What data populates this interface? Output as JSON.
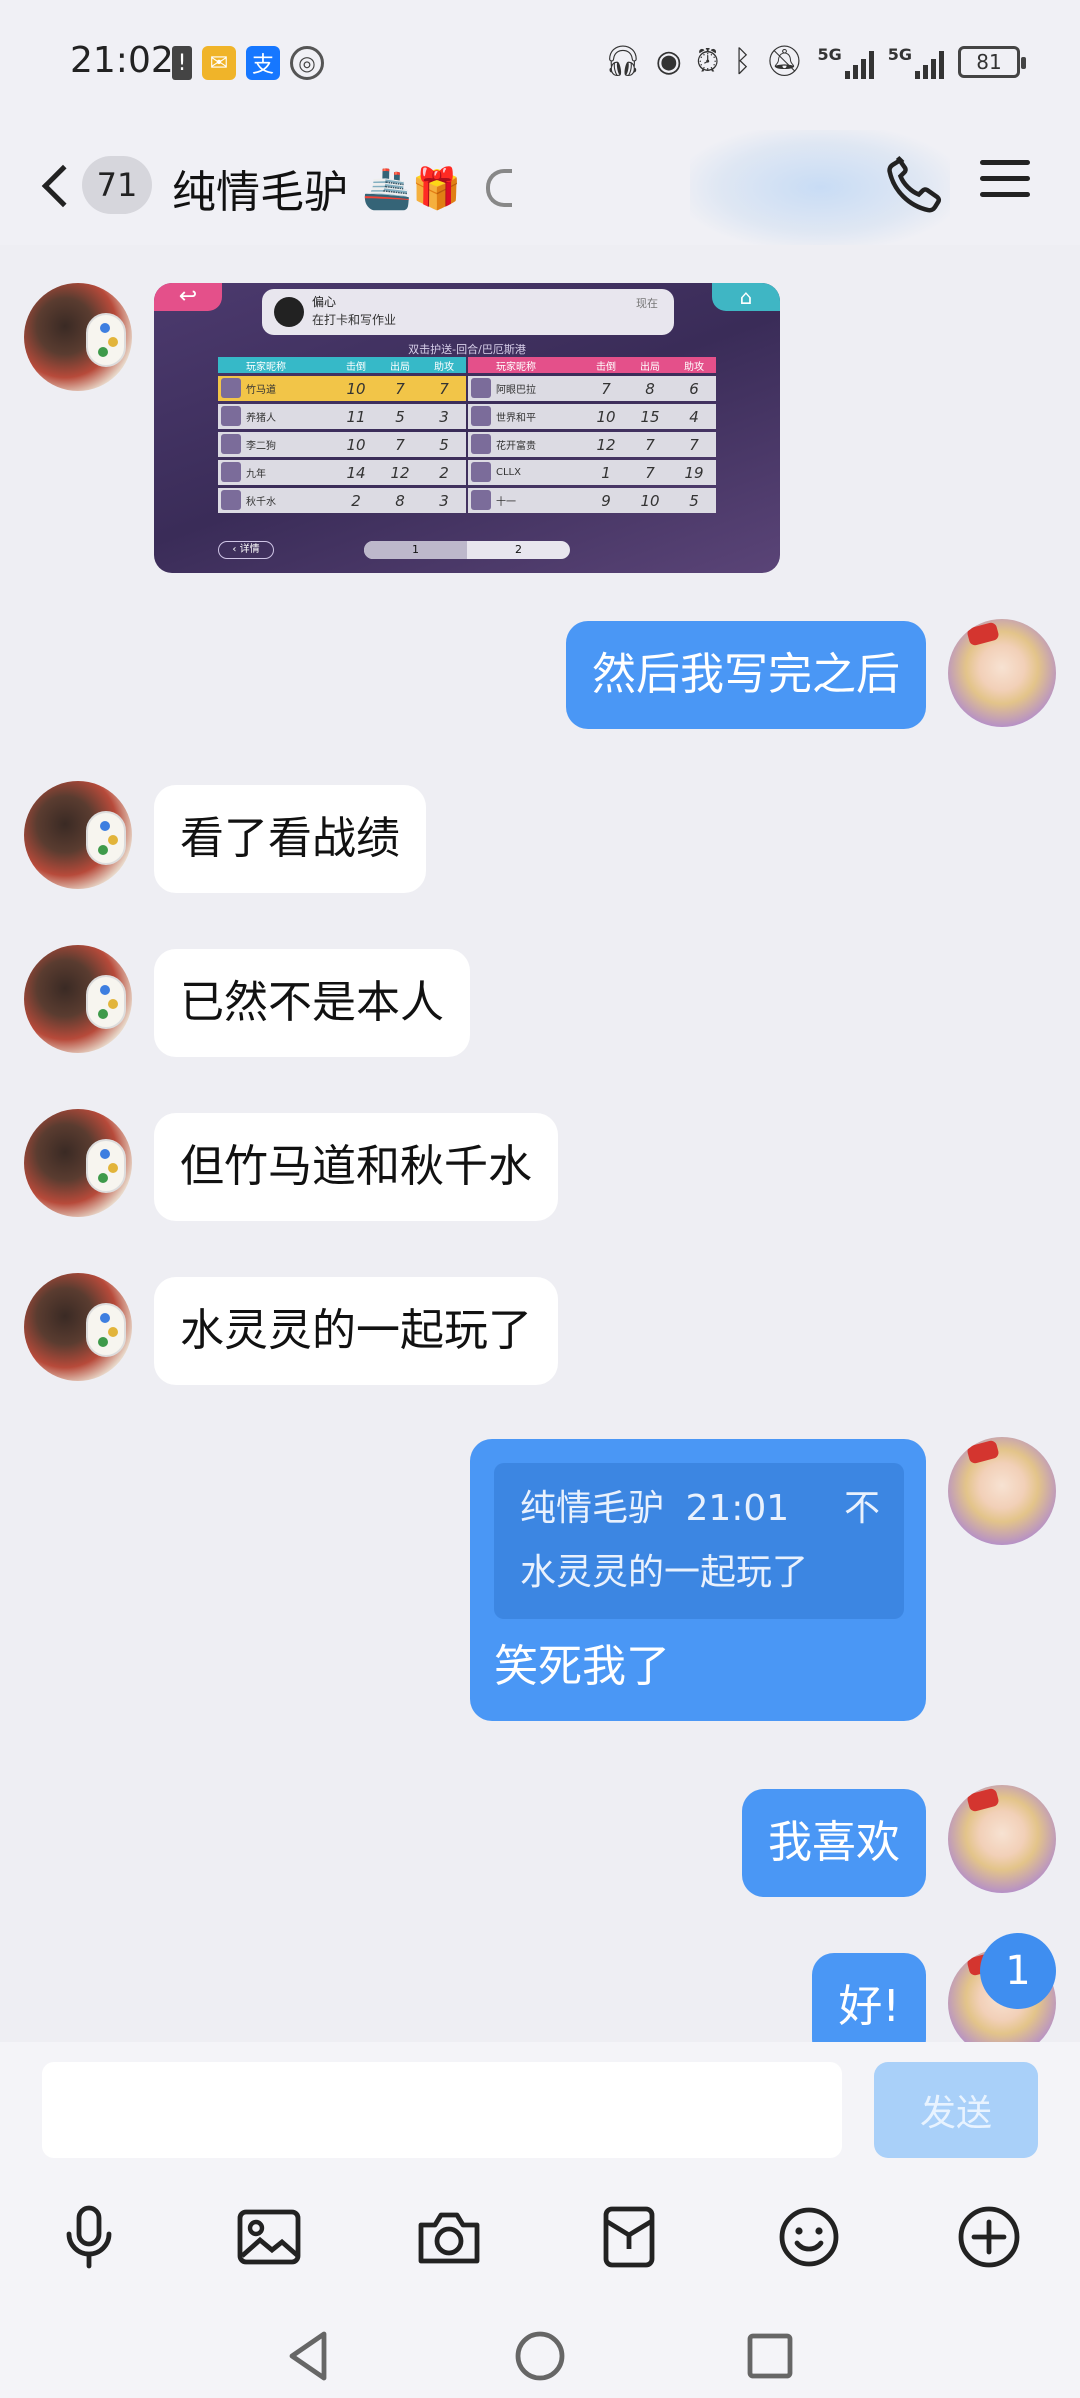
{
  "status_bar": {
    "time": "21:02",
    "left_icons": [
      "alert-icon",
      "mail-icon",
      "alipay-icon",
      "globe-icon"
    ],
    "right_icons": [
      "headphones-icon",
      "eye-icon",
      "alarm-icon",
      "bluetooth-icon",
      "mute-icon",
      "signal-5g-icon",
      "signal-5g-icon"
    ],
    "network_1": "5G",
    "network_2": "5G",
    "battery": "81"
  },
  "header": {
    "unread_count": "71",
    "title": "纯情毛驴",
    "title_emojis": "🚢🎁"
  },
  "game_screenshot": {
    "notify_name": "偏心",
    "notify_text": "在打卡和写作业",
    "notify_time": "现在",
    "subtitle": "双击护送-回合/巴厄斯港",
    "columns": [
      "玩家昵称",
      "击倒",
      "出局",
      "助攻"
    ],
    "left_team": [
      {
        "name": "竹马道",
        "kills": "10",
        "deaths": "7",
        "assists": "7"
      },
      {
        "name": "养猪人",
        "kills": "11",
        "deaths": "5",
        "assists": "3"
      },
      {
        "name": "李二狗",
        "kills": "10",
        "deaths": "7",
        "assists": "5"
      },
      {
        "name": "九年",
        "kills": "14",
        "deaths": "12",
        "assists": "2"
      },
      {
        "name": "秋千水",
        "kills": "2",
        "deaths": "8",
        "assists": "3"
      }
    ],
    "right_team": [
      {
        "name": "阿眼巴拉",
        "kills": "7",
        "deaths": "8",
        "assists": "6"
      },
      {
        "name": "世界和平",
        "kills": "10",
        "deaths": "15",
        "assists": "4"
      },
      {
        "name": "花开富贵",
        "kills": "12",
        "deaths": "7",
        "assists": "7"
      },
      {
        "name": "CLLX",
        "kills": "1",
        "deaths": "7",
        "assists": "19"
      },
      {
        "name": "十一",
        "kills": "9",
        "deaths": "10",
        "assists": "5"
      }
    ],
    "detail_label": "详情",
    "page_1": "1",
    "page_2": "2"
  },
  "messages": {
    "m1": "然后我写完之后",
    "m2": "看了看战绩",
    "m3": "已然不是本人",
    "m4": "但竹马道和秋千水",
    "m5": "水灵灵的一起玩了",
    "quote_author": "纯情毛驴",
    "quote_time": "21:01",
    "quote_close": "不",
    "quote_text": "水灵灵的一起玩了",
    "m6": "笑死我了",
    "m7": "我喜欢",
    "m8": "好!"
  },
  "new_message_badge": "1",
  "input": {
    "value": "",
    "placeholder": "",
    "send_label": "发送"
  },
  "toolbar": [
    "microphone-icon",
    "image-icon",
    "camera-icon",
    "red-packet-icon",
    "emoji-icon",
    "plus-icon"
  ],
  "nav": [
    "back-nav-icon",
    "home-nav-icon",
    "recents-nav-icon"
  ]
}
